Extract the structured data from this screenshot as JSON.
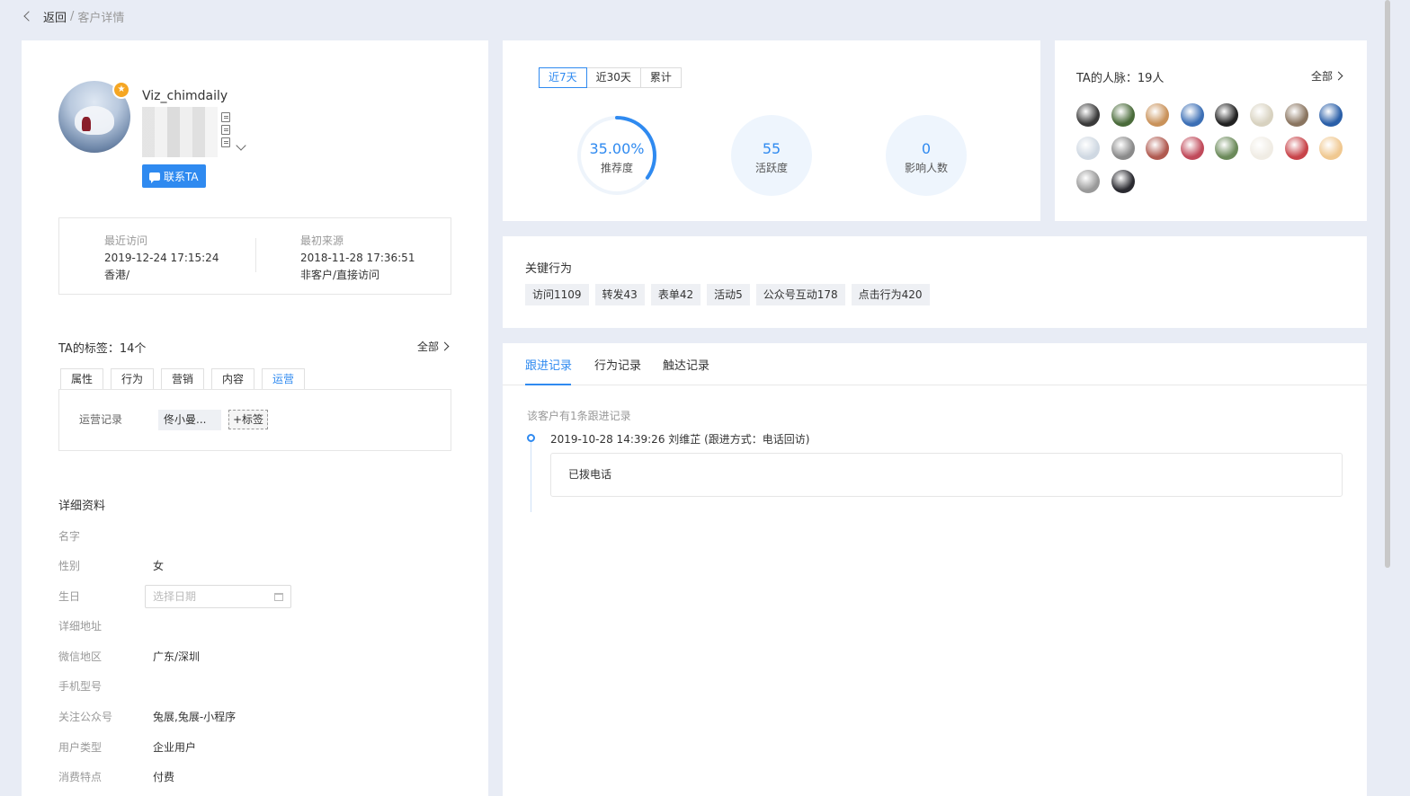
{
  "breadcrumb": {
    "back": "返回",
    "separator": "/",
    "current": "客户详情"
  },
  "profile": {
    "name": "Viz_chimdaily",
    "badge_icon": "star-icon",
    "contact_button": "联系TA"
  },
  "visits": {
    "recent": {
      "label": "最近访问",
      "time": "2019-12-24 17:15:24",
      "place": "香港/"
    },
    "first": {
      "label": "最初来源",
      "time": "2018-11-28 17:36:51",
      "place": "非客户/直接访问"
    }
  },
  "tags": {
    "title": "TA的标签：14个",
    "more": "全部",
    "tabs": [
      "属性",
      "行为",
      "营销",
      "内容",
      "运营"
    ],
    "active_tab": "运营",
    "row_label": "运营记录",
    "chip": "佟小曼...",
    "add": "+标签"
  },
  "details": {
    "title": "详细资料",
    "rows": [
      {
        "k": "名字",
        "v": ""
      },
      {
        "k": "性别",
        "v": "女"
      },
      {
        "k": "生日",
        "v": ""
      },
      {
        "k": "详细地址",
        "v": ""
      },
      {
        "k": "微信地区",
        "v": "广东/深圳"
      },
      {
        "k": "手机型号",
        "v": ""
      },
      {
        "k": "关注公众号",
        "v": "兔展,兔展-小程序"
      },
      {
        "k": "用户类型",
        "v": "企业用户"
      },
      {
        "k": "消费特点",
        "v": "付费"
      }
    ],
    "birthday_placeholder": "选择日期"
  },
  "stats": {
    "ranges": [
      "近7天",
      "近30天",
      "累计"
    ],
    "active_range": "近7天",
    "recommend": {
      "value": "35.00%",
      "label": "推荐度",
      "fraction": 0.35
    },
    "activity": {
      "value": "55",
      "label": "活跃度"
    },
    "influence": {
      "value": "0",
      "label": "影响人数"
    }
  },
  "network": {
    "title": "TA的人脉：19人",
    "more": "全部",
    "avatar_colors": [
      "#3a3a3a",
      "#4a6b3a",
      "#c9925a",
      "#3c6fb5",
      "#222222",
      "#d8d2c0",
      "#8a7560",
      "#2a5fa8",
      "#cfd8e2",
      "#8a8a8a",
      "#b05a50",
      "#c04a5a",
      "#6b8a5a",
      "#f0ece4",
      "#c8444a",
      "#f0c890",
      "#999999",
      "#2a2a30"
    ]
  },
  "behavior": {
    "title": "关键行为",
    "chips": [
      "访问1109",
      "转发43",
      "表单42",
      "活动5",
      "公众号互动178",
      "点击行为420"
    ]
  },
  "records": {
    "tabs": [
      "跟进记录",
      "行为记录",
      "触达记录"
    ],
    "active_tab": "跟进记录",
    "count_text": "该客户有1条跟进记录",
    "entries": [
      {
        "head": "2019-10-28 14:39:26 刘维芷 (跟进方式：电话回访)",
        "body": "已拨电话"
      }
    ]
  }
}
